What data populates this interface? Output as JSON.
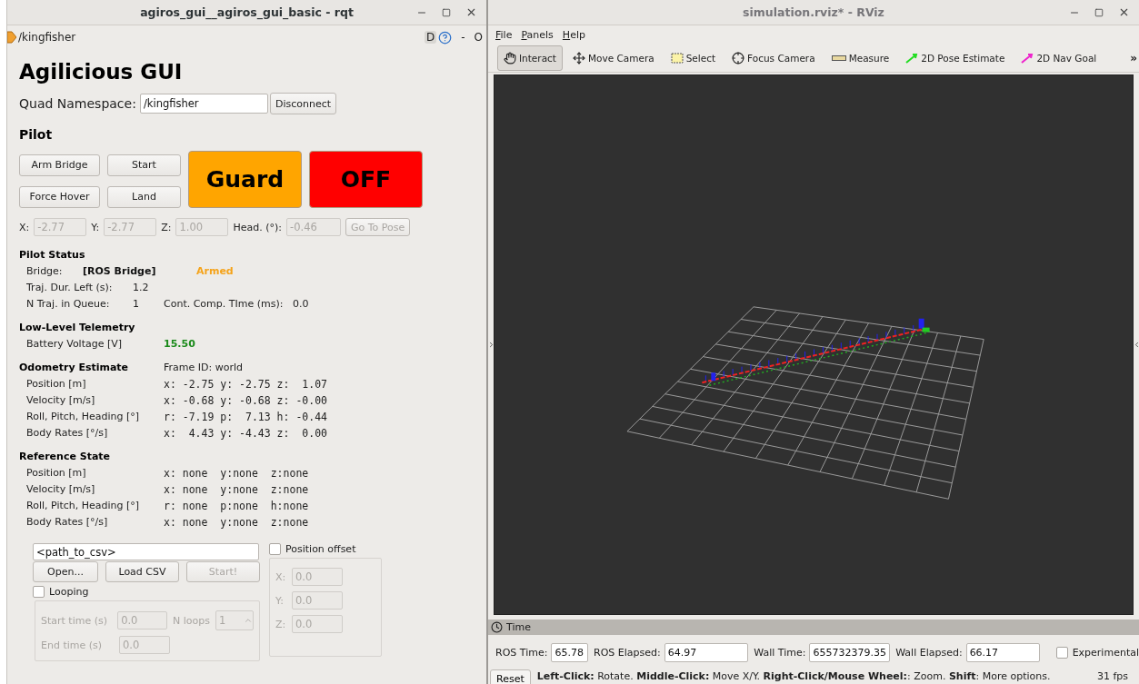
{
  "rqt": {
    "title": "agiros_gui__agiros_gui_basic - rqt",
    "plugin": {
      "title": "/kingfisher",
      "d_label": "D",
      "dash": "-",
      "o_label": "O"
    },
    "heading": "Agilicious GUI",
    "namespace": {
      "label": "Quad Namespace:",
      "value": "/kingfisher",
      "button": "Disconnect"
    },
    "pilot": {
      "title": "Pilot",
      "buttons": [
        "Arm Bridge",
        "Start",
        "Force Hover",
        "Land"
      ],
      "modes": [
        {
          "label": "Guard",
          "color": "#ffa500"
        },
        {
          "label": "OFF",
          "color": "#ff0000"
        }
      ],
      "pose": {
        "disabled": true,
        "fields": [
          {
            "label": "X:",
            "value": "-2.77"
          },
          {
            "label": "Y:",
            "value": "-2.77"
          },
          {
            "label": "Z:",
            "value": "1.00"
          },
          {
            "label": "Head. (°):",
            "value": "-0.46"
          }
        ],
        "button": "Go To Pose"
      }
    },
    "pilot_status": {
      "title": "Pilot Status",
      "rows": [
        [
          {
            "text": "Bridge:",
            "kind": "label"
          },
          {
            "text": "[ROS Bridge]",
            "kind": "bold"
          },
          {
            "text": "Armed",
            "kind": "warn"
          }
        ],
        [
          {
            "text": "Traj. Dur. Left (s):",
            "kind": "label"
          },
          {
            "text": "1.2",
            "kind": "label"
          }
        ],
        [
          {
            "text": "N Traj. in Queue:",
            "kind": "label"
          },
          {
            "text": "1",
            "kind": "label"
          },
          {
            "text": "Cont. Comp. TIme (ms):",
            "kind": "label"
          },
          {
            "text": "0.0",
            "kind": "label"
          }
        ]
      ]
    },
    "sections": [
      {
        "title": "Low-Level Telemetry",
        "rows": [
          {
            "label": "Battery Voltage [V]",
            "value": "15.50",
            "kind": "good"
          }
        ]
      },
      {
        "title": "Odometry Estimate",
        "aside": "Frame ID: world",
        "rows": [
          {
            "label": "Position [m]",
            "value": "x: -2.75 y: -2.75 z:  1.07",
            "kind": "mono"
          },
          {
            "label": "Velocity [m/s]",
            "value": "x: -0.68 y: -0.68 z: -0.00",
            "kind": "mono"
          },
          {
            "label": "Roll, Pitch, Heading [°]",
            "value": "r: -7.19 p:  7.13 h: -0.44",
            "kind": "mono"
          },
          {
            "label": "Body Rates [°/s]",
            "value": "x:  4.43 y: -4.43 z:  0.00",
            "kind": "mono"
          }
        ]
      },
      {
        "title": "Reference State",
        "rows": [
          {
            "label": "Position [m]",
            "value": "x: none  y:none  z:none",
            "kind": "mono"
          },
          {
            "label": "Velocity [m/s]",
            "value": "x: none  y:none  z:none",
            "kind": "mono"
          },
          {
            "label": "Roll, Pitch, Heading [°]",
            "value": "r: none  p:none  h:none",
            "kind": "mono"
          },
          {
            "label": "Body Rates [°/s]",
            "value": "x: none  y:none  z:none",
            "kind": "mono"
          }
        ]
      }
    ],
    "trajectory": {
      "path": "<path_to_csv>",
      "buttons": [
        {
          "label": "Open...",
          "disabled": false
        },
        {
          "label": "Load CSV",
          "disabled": false
        },
        {
          "label": "Start!",
          "disabled": true
        }
      ],
      "looping": {
        "label": "Looping",
        "checked": false,
        "start_label": "Start time (s)",
        "start_value": "0.0",
        "loops_label": "N loops",
        "loops_value": "1",
        "end_label": "End time (s)",
        "end_value": "0.0"
      },
      "offset": {
        "label": "Position offset",
        "checked": false,
        "fields": [
          {
            "label": "X:",
            "value": "0.0"
          },
          {
            "label": "Y:",
            "value": "0.0"
          },
          {
            "label": "Z:",
            "value": "0.0"
          }
        ]
      }
    }
  },
  "rviz": {
    "title": "simulation.rviz* - RViz",
    "menu": [
      "File",
      "Panels",
      "Help"
    ],
    "tools": [
      {
        "label": "Interact",
        "kind": "interact",
        "selected": true
      },
      {
        "label": "Move Camera",
        "kind": "move",
        "selected": false
      },
      {
        "label": "Select",
        "kind": "select",
        "selected": false
      },
      {
        "label": "Focus Camera",
        "kind": "focus",
        "selected": false
      },
      {
        "label": "Measure",
        "kind": "measure",
        "selected": false
      },
      {
        "label": "2D Pose Estimate",
        "kind": "pose",
        "selected": false
      },
      {
        "label": "2D Nav Goal",
        "kind": "goal",
        "selected": false
      }
    ],
    "more": "»",
    "time": {
      "title": "Time",
      "fields": [
        {
          "label": "ROS Time:",
          "value": "65.78"
        },
        {
          "label": "ROS Elapsed:",
          "value": "64.97"
        },
        {
          "label": "Wall Time:",
          "value": "655732379.35"
        },
        {
          "label": "Wall Elapsed:",
          "value": "66.17"
        }
      ],
      "experimental": {
        "label": "Experimental",
        "checked": false
      }
    },
    "status": {
      "button": "Reset",
      "hint": "**Left-Click:** Rotate. **Middle-Click:** Move X/Y. **Right-Click/Mouse Wheel:**: Zoom. **Shift**: More options.",
      "fps": "31 fps"
    }
  }
}
